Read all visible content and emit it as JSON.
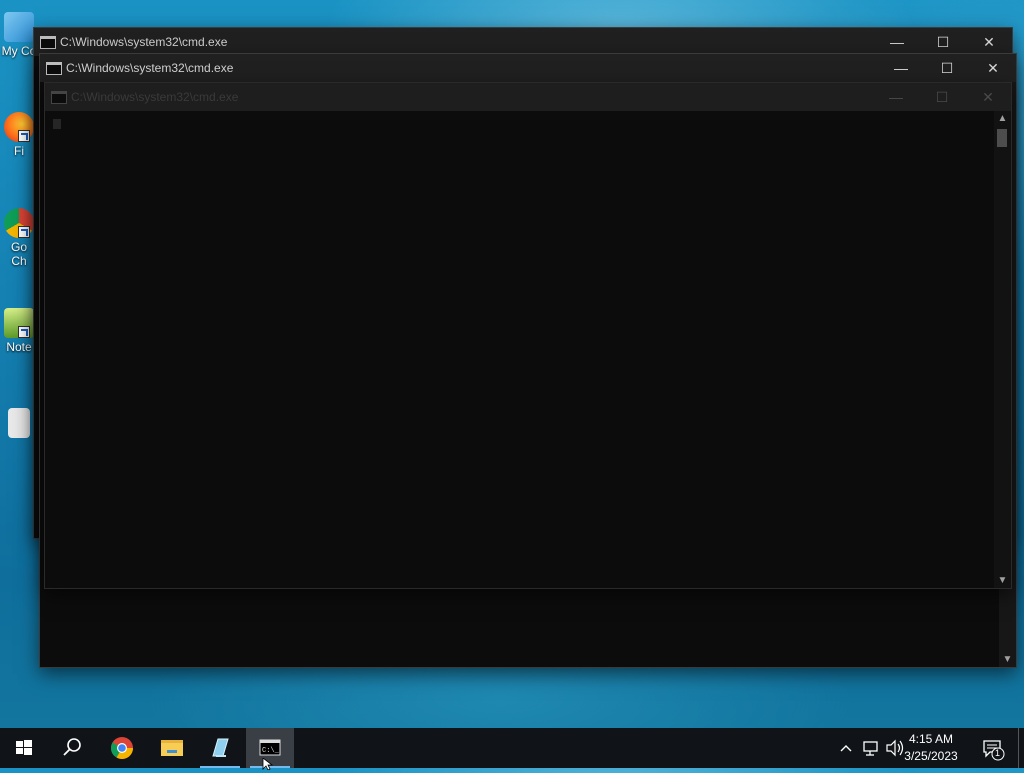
{
  "desktop": {
    "icons": [
      {
        "label": "My Co",
        "icon": "computer-icon"
      },
      {
        "label": "Fi",
        "icon": "firefox-icon"
      },
      {
        "label": "Go",
        "label2": "Ch",
        "icon": "chrome-icon"
      },
      {
        "label": "Note",
        "icon": "notepad-icon"
      },
      {
        "label": "",
        "icon": "file-icon"
      }
    ]
  },
  "windows": [
    {
      "title": "C:\\Windows\\system32\\cmd.exe",
      "minimize": "—",
      "maximize": "☐",
      "close": "✕"
    },
    {
      "title": "C:\\Windows\\system32\\cmd.exe",
      "minimize": "—",
      "maximize": "☐",
      "close": "✕"
    },
    {
      "title": "C:\\Windows\\system32\\cmd.exe",
      "minimize": "—",
      "maximize": "☐",
      "close": "✕"
    }
  ],
  "taskbar": {
    "items": [
      {
        "name": "start",
        "icon": "windows-start-icon"
      },
      {
        "name": "search",
        "icon": "search-icon"
      },
      {
        "name": "chrome",
        "icon": "chrome-icon"
      },
      {
        "name": "file-explorer",
        "icon": "folder-icon"
      },
      {
        "name": "app",
        "icon": "app-icon"
      },
      {
        "name": "cmd",
        "icon": "cmd-icon",
        "active": true
      }
    ],
    "clock": {
      "time": "4:15 AM",
      "date": "3/25/2023"
    },
    "notification_count": "1",
    "accent": "#76b9ed"
  }
}
